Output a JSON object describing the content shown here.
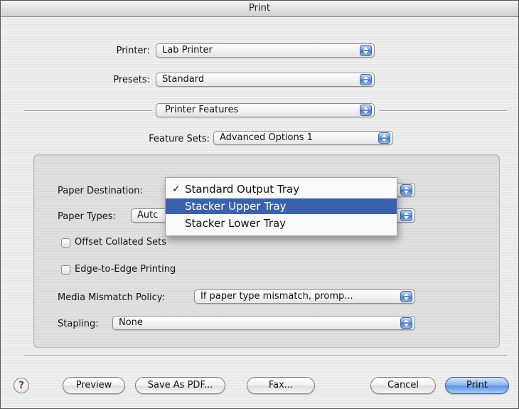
{
  "window": {
    "title": "Print"
  },
  "printer": {
    "label": "Printer:",
    "value": "Lab Printer"
  },
  "presets": {
    "label": "Presets:",
    "value": "Standard"
  },
  "pane": {
    "value": "Printer Features"
  },
  "feature_sets": {
    "label": "Feature Sets:",
    "value": "Advanced Options 1"
  },
  "options": {
    "paper_destination": {
      "label": "Paper Destination:"
    },
    "paper_types": {
      "label": "Paper Types:",
      "value": "Autc"
    },
    "offset_collated": {
      "label": "Offset Collated Sets",
      "checked": false
    },
    "edge_to_edge": {
      "label": "Edge-to-Edge Printing",
      "checked": false
    },
    "media_mismatch": {
      "label": "Media Mismatch Policy:",
      "value": "If paper type mismatch, promp..."
    },
    "stapling": {
      "label": "Stapling:",
      "value": "None"
    }
  },
  "menu": {
    "items": [
      {
        "label": "Standard Output Tray",
        "checked": true
      },
      {
        "label": "Stacker Upper Tray",
        "highlighted": true
      },
      {
        "label": "Stacker Lower Tray"
      }
    ]
  },
  "buttons": {
    "help": "?",
    "preview": "Preview",
    "save_pdf": "Save As PDF...",
    "fax": "Fax...",
    "cancel": "Cancel",
    "print": "Print"
  },
  "colors": {
    "accent": "#3a61ad",
    "default_button": "#5b94e2"
  }
}
